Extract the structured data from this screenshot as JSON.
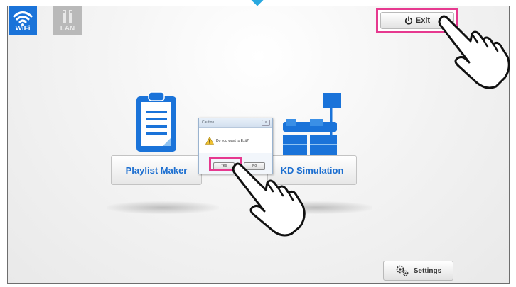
{
  "network": {
    "wifi_label": "WiFi",
    "lan_label": "LAN"
  },
  "header": {
    "exit_label": "Exit"
  },
  "apps": [
    {
      "label": "Playlist Maker"
    },
    {
      "label": "KD Simulation"
    }
  ],
  "dialog": {
    "title": "Caution",
    "message": "Do you want to Exit?",
    "yes_label": "Yes",
    "no_label": "No"
  },
  "footer": {
    "settings_label": "Settings"
  },
  "colors": {
    "accent": "#1a73d9",
    "highlight": "#e6398f",
    "marker": "#29a8df"
  },
  "icons": [
    "wifi-icon",
    "lan-icon",
    "power-icon",
    "clipboard-icon",
    "stage-icon",
    "warning-icon",
    "gears-icon",
    "pointing-hand-icon"
  ]
}
